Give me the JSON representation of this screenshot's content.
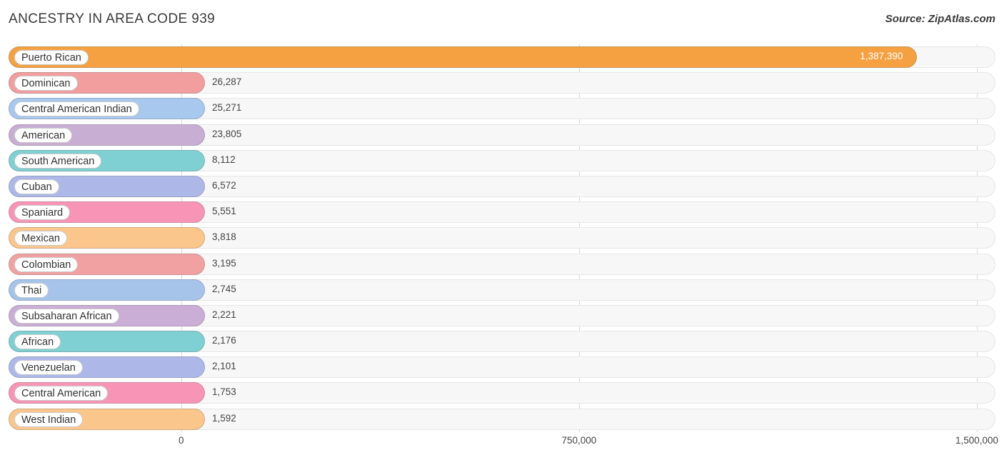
{
  "header": {
    "title": "ANCESTRY IN AREA CODE 939",
    "source": "Source: ZipAtlas.com"
  },
  "chart_data": {
    "type": "bar",
    "orientation": "horizontal",
    "title": "ANCESTRY IN AREA CODE 939",
    "xlabel": "",
    "ylabel": "",
    "xlim": [
      0,
      1500000
    ],
    "ticks": [
      "0",
      "750,000",
      "1,500,000"
    ],
    "tick_values": [
      0,
      750000,
      1500000
    ],
    "grid": true,
    "legend": null,
    "categories": [
      "Puerto Rican",
      "Dominican",
      "Central American Indian",
      "American",
      "South American",
      "Cuban",
      "Spaniard",
      "Mexican",
      "Colombian",
      "Thai",
      "Subsaharan African",
      "African",
      "Venezuelan",
      "Central American",
      "West Indian"
    ],
    "values": [
      1387390,
      26287,
      25271,
      23805,
      8112,
      6572,
      5551,
      3818,
      3195,
      2745,
      2221,
      2176,
      2101,
      1753,
      1592
    ],
    "value_labels": [
      "1,387,390",
      "26,287",
      "25,271",
      "23,805",
      "8,112",
      "6,572",
      "5,551",
      "3,818",
      "3,195",
      "2,745",
      "2,221",
      "2,176",
      "2,101",
      "1,753",
      "1,592"
    ],
    "bar_colors": [
      "#f5a142",
      "#f29e9e",
      "#a8c8ee",
      "#c9aed4",
      "#7fd0d3",
      "#adb8e8",
      "#f895b6",
      "#fbc68c",
      "#f1a1a1",
      "#a6c4ea",
      "#cbaed6",
      "#7fd0d3",
      "#adb8e8",
      "#f895b6",
      "#fbc68c"
    ],
    "min_bar_pixels": 275
  }
}
